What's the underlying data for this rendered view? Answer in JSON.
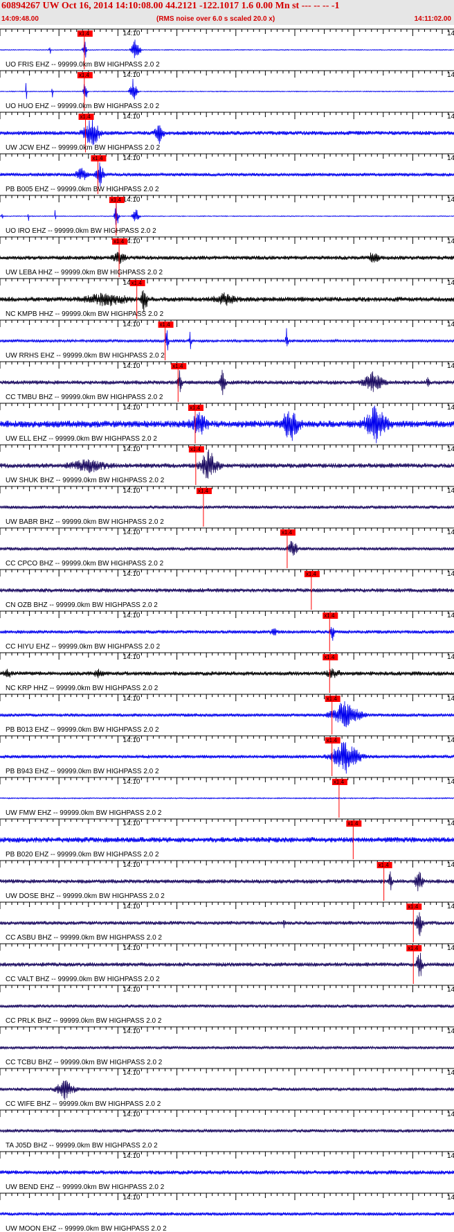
{
  "header": {
    "title": "60894267 UW Oct 16, 2014 14:10:08.00   44.2121 -122.1017  1.6 0.00 Mn st --- -- --   -1",
    "start_time": "14:09:48.00",
    "noise_note": "(RMS noise over 6.0 s scaled 20.0 x)",
    "end_time": "14:11:02.00"
  },
  "colors": {
    "blue": "#0000ee",
    "black": "#000000",
    "purple": "#1a0a60",
    "pick": "#ff0000"
  },
  "chart_data": {
    "type": "line",
    "x_range": [
      "14:09:48.00",
      "14:11:02.00"
    ],
    "tick_label": "14:10",
    "right_tick_label": "14",
    "pick_label": "x1.4",
    "grid": false,
    "traces": [
      {
        "label": "UO FRIS EHZ -- 99999.0km BW  HIGHPASS  2.0  2",
        "color": "blue",
        "pick": 14.3,
        "noise": 0.6,
        "bursts": [
          [
            8.4,
            0.15,
            14
          ],
          [
            14.3,
            0.5,
            22
          ],
          [
            23.0,
            1.2,
            20
          ]
        ]
      },
      {
        "label": "UO HUO EHZ -- 99999.0km BW  HIGHPASS  2.0  2",
        "color": "blue",
        "pick": 14.3,
        "noise": 0.6,
        "bursts": [
          [
            4.4,
            0.15,
            12
          ],
          [
            8.8,
            0.2,
            12
          ],
          [
            14.4,
            0.5,
            22
          ],
          [
            22.6,
            1.0,
            20
          ]
        ]
      },
      {
        "label": "UW JCW EHZ -- 99999.0km BW  HIGHPASS  2.0  2",
        "color": "blue",
        "pick": 14.5,
        "noise": 3,
        "bursts": [
          [
            15.5,
            2.2,
            22
          ],
          [
            27.0,
            1.2,
            14
          ]
        ]
      },
      {
        "label": "PB B005 EHZ -- 99999.0km BW  HIGHPASS  2.0  2",
        "color": "blue",
        "pick": 16.6,
        "noise": 2.5,
        "bursts": [
          [
            13.8,
            1.5,
            10
          ],
          [
            16.9,
            1.2,
            18
          ]
        ]
      },
      {
        "label": "UO IRO EHZ -- 99999.0km BW  HIGHPASS  2.0  2",
        "color": "blue",
        "pick": 19.7,
        "noise": 0.6,
        "bursts": [
          [
            0.3,
            0.15,
            12
          ],
          [
            4.8,
            0.15,
            12
          ],
          [
            9.3,
            0.15,
            12
          ],
          [
            19.7,
            0.6,
            20
          ],
          [
            23.0,
            0.9,
            14
          ]
        ]
      },
      {
        "label": "UW LEBA HHZ -- 99999.0km BW  HIGHPASS  2.0  2",
        "color": "black",
        "pick": 20.2,
        "noise": 3,
        "bursts": [
          [
            20.2,
            1.8,
            8
          ],
          [
            63.3,
            1.5,
            8
          ]
        ]
      },
      {
        "label": "NC KMPB HHZ -- 99999.0km BW  HIGHPASS  2.0  2",
        "color": "black",
        "pick": 23.2,
        "noise": 3.5,
        "bursts": [
          [
            18.0,
            6.0,
            8
          ],
          [
            24.4,
            1.0,
            18
          ],
          [
            38.0,
            3.0,
            8
          ]
        ]
      },
      {
        "label": "UW RRHS EHZ -- 99999.0km BW  HIGHPASS  2.0  2",
        "color": "blue",
        "pick": 28.0,
        "noise": 2,
        "bursts": [
          [
            28.3,
            0.4,
            18
          ],
          [
            32.2,
            0.3,
            14
          ],
          [
            48.6,
            0.3,
            18
          ]
        ]
      },
      {
        "label": "CC TMBU BHZ -- 99999.0km BW  HIGHPASS  2.0  2",
        "color": "purple",
        "pick": 30.2,
        "noise": 3,
        "bursts": [
          [
            30.4,
            0.6,
            18
          ],
          [
            37.7,
            0.8,
            16
          ],
          [
            63.3,
            2.8,
            14
          ],
          [
            72.6,
            0.4,
            10
          ]
        ]
      },
      {
        "label": "UW ELL EHZ -- 99999.0km BW  HIGHPASS  2.0  2",
        "color": "blue",
        "pick": 33.1,
        "noise": 5,
        "bursts": [
          [
            33.8,
            2.4,
            14
          ],
          [
            49.2,
            2.4,
            24
          ],
          [
            63.7,
            3.2,
            24
          ]
        ]
      },
      {
        "label": "UW SHUK BHZ -- 99999.0km BW  HIGHPASS  2.0  2",
        "color": "purple",
        "pick": 33.2,
        "noise": 3.5,
        "bursts": [
          [
            15.0,
            5.0,
            8
          ],
          [
            35.4,
            2.6,
            22
          ]
        ]
      },
      {
        "label": "UW BABR BHZ -- 99999.0km BW  HIGHPASS  2.0  2",
        "color": "purple",
        "pick": 34.5,
        "noise": 2.5,
        "bursts": []
      },
      {
        "label": "CC CPCO BHZ -- 99999.0km BW  HIGHPASS  2.0  2",
        "color": "purple",
        "pick": 48.7,
        "noise": 2.5,
        "bursts": [
          [
            49.6,
            1.3,
            14
          ]
        ]
      },
      {
        "label": "CN OZB BHZ -- 99999.0km BW  HIGHPASS  2.0  2",
        "color": "purple",
        "pick": 52.8,
        "noise": 3,
        "bursts": []
      },
      {
        "label": "CC HIYU EHZ -- 99999.0km BW  HIGHPASS  2.0  2",
        "color": "blue",
        "pick": 55.9,
        "noise": 2.5,
        "bursts": [
          [
            46.4,
            1.0,
            5
          ],
          [
            56.3,
            0.5,
            14
          ]
        ]
      },
      {
        "label": "NC KRP HHZ -- 99999.0km BW  HIGHPASS  2.0  2",
        "color": "black",
        "pick": 55.9,
        "noise": 3,
        "bursts": [
          [
            1.3,
            1.2,
            5
          ],
          [
            16.6,
            1.2,
            5
          ],
          [
            56.5,
            2.0,
            6
          ]
        ]
      },
      {
        "label": "PB B013 EHZ -- 99999.0km BW  HIGHPASS  2.0  2",
        "color": "blue",
        "pick": 56.3,
        "noise": 2.5,
        "bursts": [
          [
            58.5,
            4.0,
            22
          ]
        ]
      },
      {
        "label": "PB B943 EHZ -- 99999.0km BW  HIGHPASS  2.0  2",
        "color": "blue",
        "pick": 56.3,
        "noise": 2.5,
        "bursts": [
          [
            58.5,
            4.0,
            24
          ]
        ]
      },
      {
        "label": "UW FMW EHZ -- 99999.0km BW  HIGHPASS  2.0  2",
        "color": "blue",
        "pick": 57.5,
        "noise": 0.8,
        "bursts": []
      },
      {
        "label": "PB B020 EHZ -- 99999.0km BW  HIGHPASS  2.0  2",
        "color": "blue",
        "pick": 59.9,
        "noise": 4,
        "bursts": []
      },
      {
        "label": "UW DOSE BHZ -- 99999.0km BW  HIGHPASS  2.0  2",
        "color": "purple",
        "pick": 65.1,
        "noise": 3,
        "bursts": [
          [
            66.1,
            0.6,
            16
          ],
          [
            71.0,
            1.0,
            20
          ]
        ]
      },
      {
        "label": "CC ASBU BHZ -- 99999.0km BW  HIGHPASS  2.0  2",
        "color": "purple",
        "pick": 70.1,
        "noise": 2.8,
        "bursts": [
          [
            48.1,
            0.3,
            7
          ],
          [
            71.1,
            1.0,
            20
          ]
        ]
      },
      {
        "label": "CC VALT BHZ -- 99999.0km BW  HIGHPASS  2.0  2",
        "color": "purple",
        "pick": 70.1,
        "noise": 3,
        "bursts": [
          [
            71.1,
            0.8,
            24
          ]
        ]
      },
      {
        "label": "CC PRLK BHZ -- 99999.0km BW  HIGHPASS  2.0  2",
        "color": "purple",
        "pick": null,
        "noise": 2.5,
        "bursts": []
      },
      {
        "label": "CC TCBU BHZ -- 99999.0km BW  HIGHPASS  2.0  2",
        "color": "purple",
        "pick": null,
        "noise": 2.2,
        "bursts": []
      },
      {
        "label": "CC WIFE BHZ -- 99999.0km BW  HIGHPASS  2.0  2",
        "color": "purple",
        "pick": null,
        "noise": 2.5,
        "bursts": [
          [
            11.0,
            2.5,
            14
          ]
        ]
      },
      {
        "label": "TA J05D BHZ -- 99999.0km BW  HIGHPASS  2.0  2",
        "color": "purple",
        "pick": null,
        "noise": 2.5,
        "bursts": []
      },
      {
        "label": "UW BEND EHZ -- 99999.0km BW  HIGHPASS  2.0  2",
        "color": "blue",
        "pick": null,
        "noise": 3,
        "bursts": []
      },
      {
        "label": "UW MOON EHZ -- 99999.0km BW  HIGHPASS  2.0  2",
        "color": "blue",
        "pick": null,
        "noise": 2.5,
        "bursts": []
      }
    ]
  }
}
